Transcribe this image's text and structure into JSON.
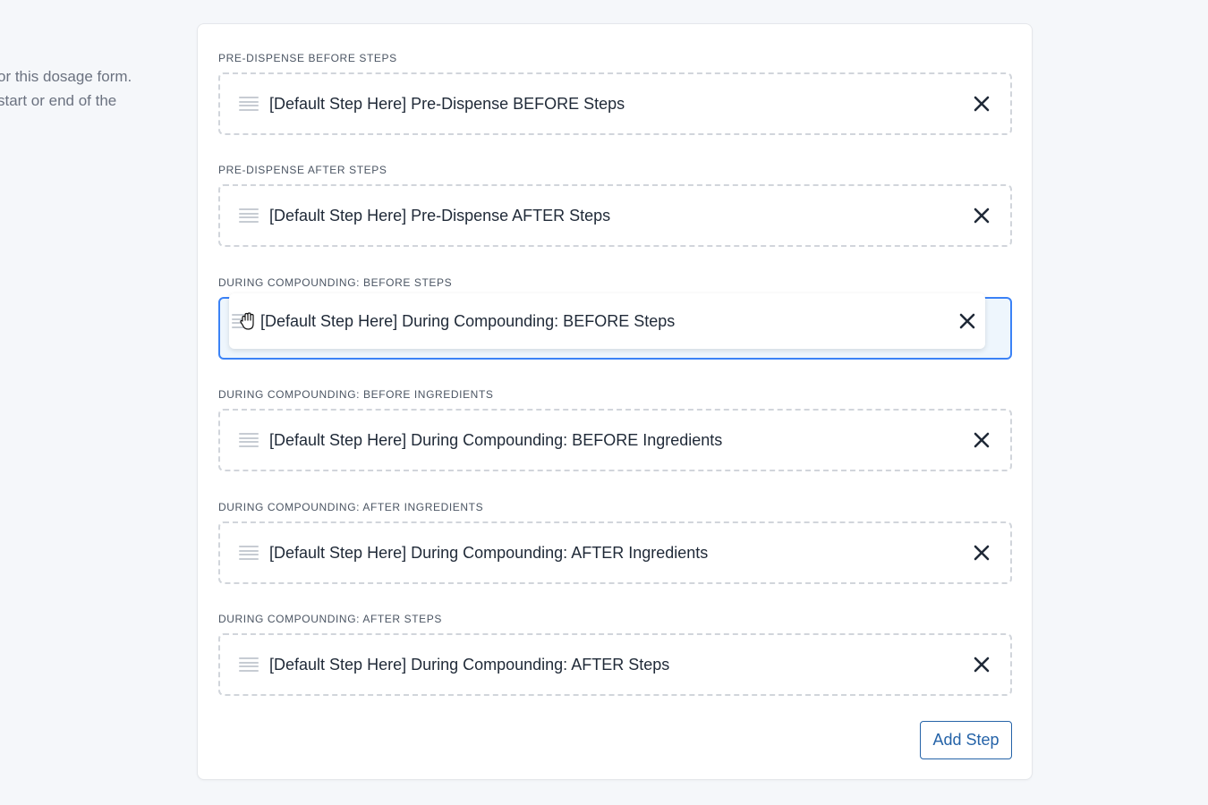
{
  "description": {
    "line1": "or this dosage form.",
    "line2": "start or end of the"
  },
  "sections": [
    {
      "label": "PRE-DISPENSE BEFORE STEPS",
      "step": "[Default Step Here] Pre-Dispense BEFORE Steps"
    },
    {
      "label": "PRE-DISPENSE AFTER STEPS",
      "step": "[Default Step Here] Pre-Dispense AFTER Steps"
    },
    {
      "label": "DURING COMPOUNDING: BEFORE STEPS",
      "step": "[Default Step Here] During Compounding: BEFORE Steps",
      "state": "dragging"
    },
    {
      "label": "DURING COMPOUNDING: BEFORE INGREDIENTS",
      "step": "[Default Step Here] During Compounding: BEFORE Ingredients"
    },
    {
      "label": "DURING COMPOUNDING: AFTER INGREDIENTS",
      "step": "[Default Step Here] During Compounding: AFTER Ingredients"
    },
    {
      "label": "DURING COMPOUNDING: AFTER STEPS",
      "step": "[Default Step Here] During Compounding: AFTER Steps"
    }
  ],
  "icons": {
    "handle": "drag-handle-icon",
    "remove": "close-icon",
    "cursor": "grab-hand-cursor-icon"
  },
  "colors": {
    "accent": "#3b82f6",
    "button": "#2563a8",
    "drop_highlight": "#eef6fd"
  },
  "add_step_label": "Add Step"
}
